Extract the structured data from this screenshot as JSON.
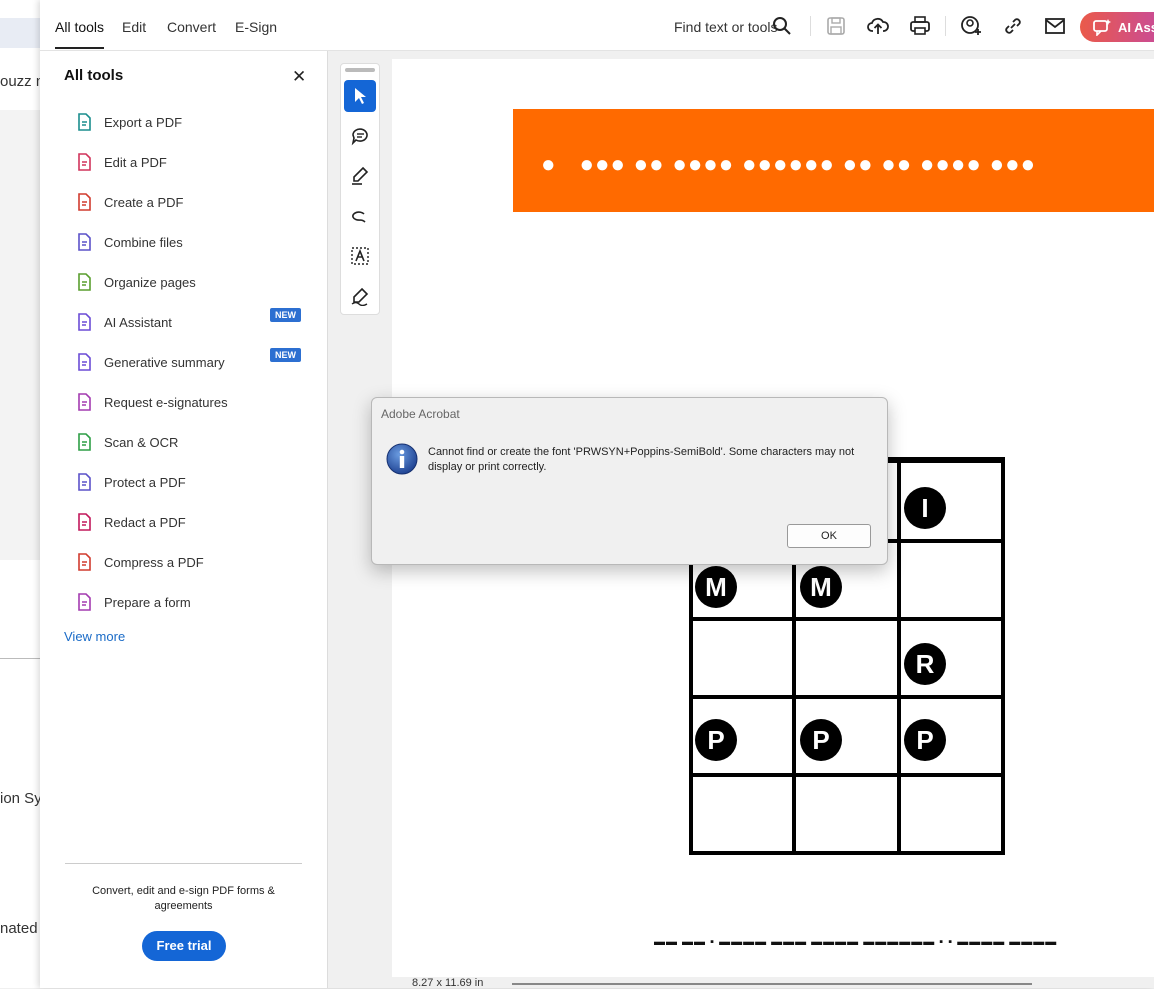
{
  "background_fragments": [
    "ouzz m",
    "ion Syr",
    "nated"
  ],
  "topbar": {
    "tabs": [
      {
        "label": "All tools"
      },
      {
        "label": "Edit"
      },
      {
        "label": "Convert"
      },
      {
        "label": "E-Sign"
      }
    ],
    "find_label": "Find text or tools",
    "ai_label": "AI Ass",
    "icons": [
      "search-icon",
      "save-icon",
      "cloud-upload-icon",
      "print-icon",
      "share-user-icon",
      "link-icon",
      "mail-icon",
      "ai-assistant-icon"
    ]
  },
  "panel": {
    "title": "All tools",
    "tools": [
      {
        "label": "Export a PDF",
        "icon": "export-pdf-icon",
        "color": "#1b8e8e"
      },
      {
        "label": "Edit a PDF",
        "icon": "edit-pdf-icon",
        "color": "#d1345b"
      },
      {
        "label": "Create a PDF",
        "icon": "create-pdf-icon",
        "color": "#d13b2f"
      },
      {
        "label": "Combine files",
        "icon": "combine-files-icon",
        "color": "#5b52c9"
      },
      {
        "label": "Organize pages",
        "icon": "organize-pages-icon",
        "color": "#5a9e2f"
      },
      {
        "label": "AI Assistant",
        "icon": "ai-assistant-icon",
        "color": "#6b4cd6",
        "badge": "NEW"
      },
      {
        "label": "Generative summary",
        "icon": "generative-summary-icon",
        "color": "#6b4cd6",
        "badge": "NEW"
      },
      {
        "label": "Request e-signatures",
        "icon": "request-esign-icon",
        "color": "#a33bb0"
      },
      {
        "label": "Scan & OCR",
        "icon": "scan-ocr-icon",
        "color": "#2e9e46"
      },
      {
        "label": "Protect a PDF",
        "icon": "protect-pdf-icon",
        "color": "#5b52c9"
      },
      {
        "label": "Redact a PDF",
        "icon": "redact-pdf-icon",
        "color": "#c2185b"
      },
      {
        "label": "Compress a PDF",
        "icon": "compress-pdf-icon",
        "color": "#d13b2f"
      },
      {
        "label": "Prepare a form",
        "icon": "prepare-form-icon",
        "color": "#a33bb0"
      }
    ],
    "view_more": "View more",
    "promo": "Convert, edit and e-sign PDF forms & agreements",
    "cta": "Free trial"
  },
  "document": {
    "page_size": "8.27 x 11.69 in",
    "banner_color": "#ff6a00",
    "chord_markers": [
      "I",
      "I",
      "M",
      "M",
      "R",
      "P",
      "P",
      "P"
    ]
  },
  "dialog": {
    "title": "Adobe Acrobat",
    "message": "Cannot find or create the font 'PRWSYN+Poppins-SemiBold'. Some characters may not display or print correctly.",
    "ok_label": "OK"
  }
}
